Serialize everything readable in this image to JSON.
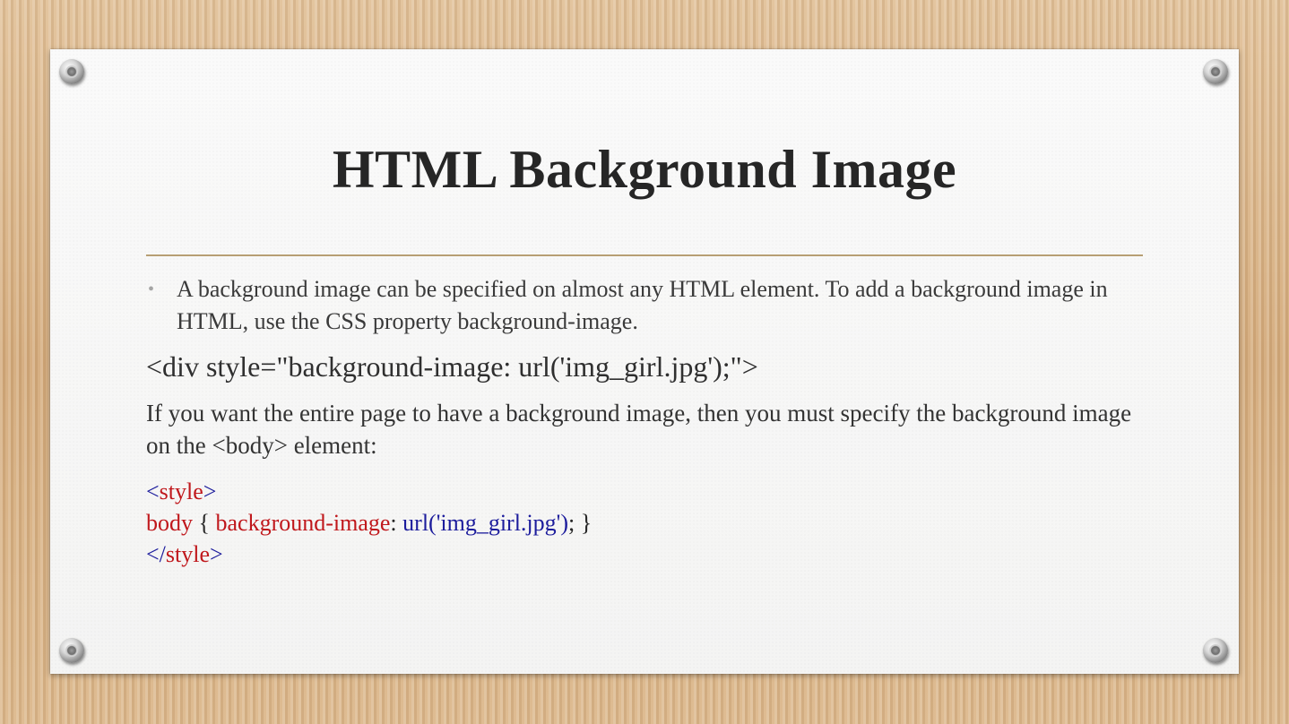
{
  "slide": {
    "title": "HTML Background Image",
    "bullet": "A background image can be specified on almost any HTML element. To add a background image in HTML, use the CSS property background-image.",
    "code_example": "<div style=\"background-image: url('img_girl.jpg');\">",
    "paragraph": "If you want the entire page to have a background image, then you must specify the background image on the <body> element:",
    "code_block": {
      "open_tag_lt": "<",
      "open_tag_name": "style",
      "open_tag_gt": ">",
      "selector": "body",
      "brace_open": " { ",
      "property": "background-image",
      "colon": ": ",
      "value": "url('img_girl.jpg')",
      "brace_close": "; }",
      "close_tag_lt": "</",
      "close_tag_name": "style",
      "close_tag_gt": ">"
    }
  },
  "colors": {
    "tag_bracket": "#1c1c9c",
    "tag_name": "#c0181c",
    "property": "#c0181c",
    "value": "#1c1c9c",
    "rule": "#b79f74"
  }
}
